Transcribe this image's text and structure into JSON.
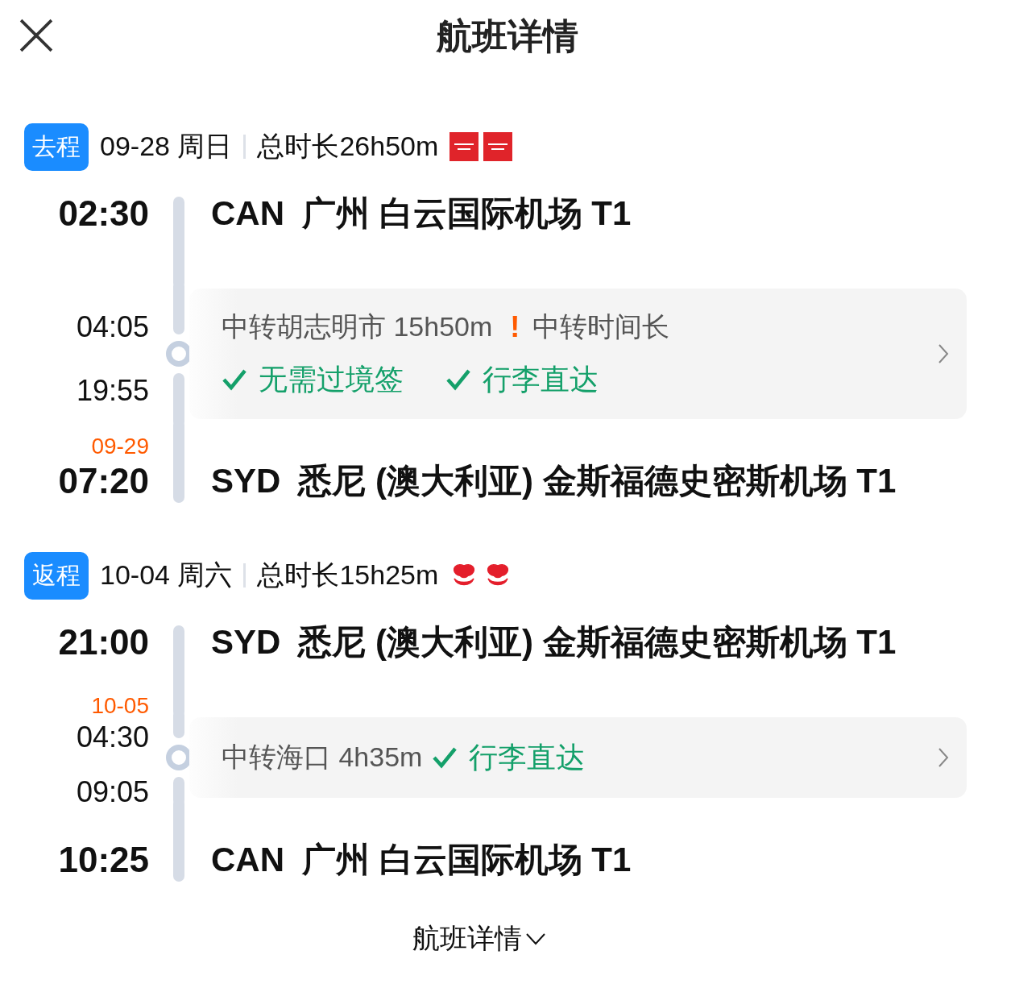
{
  "title": "航班详情",
  "legs": [
    {
      "tag": "去程",
      "date": "09-28 周日",
      "duration": "总时长26h50m",
      "logos": [
        {
          "kind": "square"
        },
        {
          "kind": "square"
        }
      ],
      "departure": {
        "time": "02:30",
        "code": "CAN",
        "airport": "广州 白云国际机场 T1"
      },
      "transfer": {
        "kind": "stacked",
        "arrive": "04:05",
        "depart": "19:55",
        "text": "中转胡志明市 15h50m",
        "warning": {
          "mark": "!",
          "text": "中转时间长"
        },
        "perks": [
          "无需过境签",
          "行李直达"
        ]
      },
      "arrival": {
        "date": "09-29",
        "time": "07:20",
        "code": "SYD",
        "airport": "悉尼 (澳大利亚) 金斯福德史密斯机场 T1"
      }
    },
    {
      "tag": "返程",
      "date": "10-04 周六",
      "duration": "总时长15h25m",
      "logos": [
        {
          "kind": "emblem"
        },
        {
          "kind": "emblem"
        }
      ],
      "departure": {
        "time": "21:00",
        "code": "SYD",
        "airport": "悉尼 (澳大利亚) 金斯福德史密斯机场 T1"
      },
      "transfer": {
        "kind": "inline",
        "arrive_date": "10-05",
        "arrive": "04:30",
        "depart": "09:05",
        "text": "中转海口 4h35m",
        "perks": [
          "行李直达"
        ]
      },
      "arrival": {
        "time": "10:25",
        "code": "CAN",
        "airport": "广州 白云国际机场 T1"
      }
    }
  ],
  "toggle": "航班详情"
}
